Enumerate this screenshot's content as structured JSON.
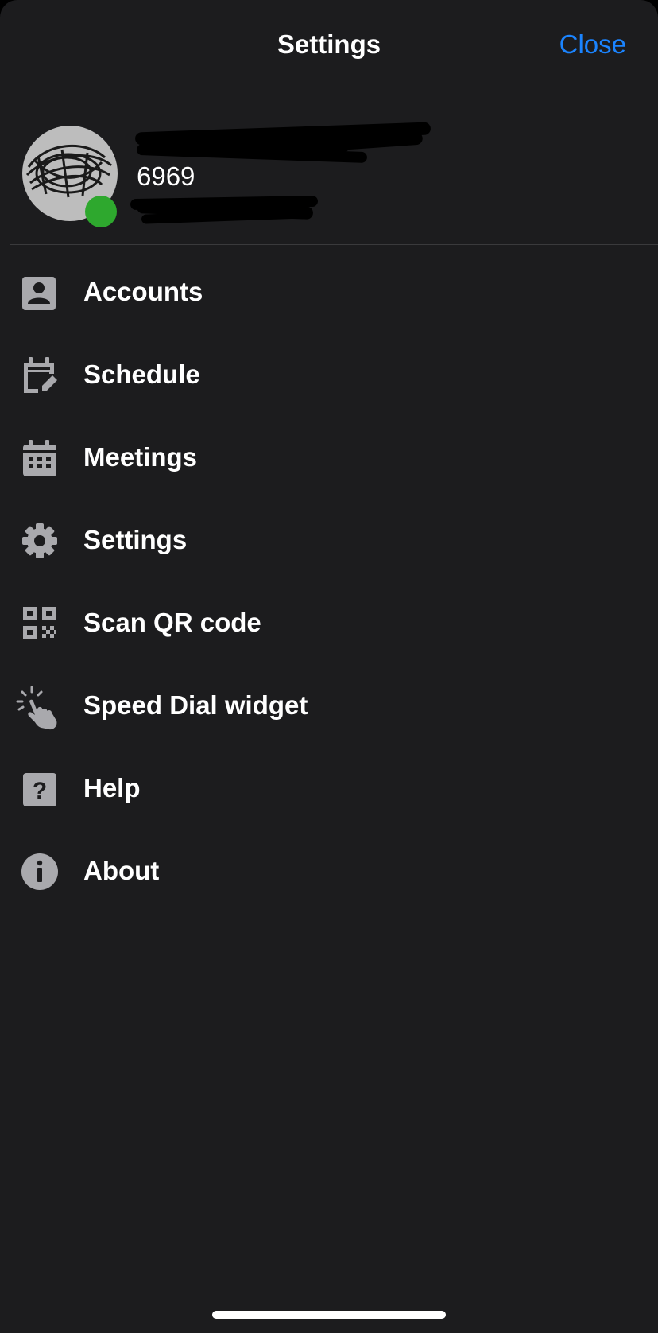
{
  "header": {
    "title": "Settings",
    "close_label": "Close"
  },
  "profile": {
    "extension": "6969",
    "presence_color": "#2ea82e",
    "name_redacted": true,
    "subtitle_redacted": true
  },
  "menu": {
    "items": [
      {
        "label": "Accounts",
        "icon": "account-box-icon"
      },
      {
        "label": "Schedule",
        "icon": "calendar-edit-icon"
      },
      {
        "label": "Meetings",
        "icon": "calendar-grid-icon"
      },
      {
        "label": "Settings",
        "icon": "gear-icon"
      },
      {
        "label": "Scan QR code",
        "icon": "qr-code-icon"
      },
      {
        "label": "Speed Dial widget",
        "icon": "tap-hand-icon"
      },
      {
        "label": "Help",
        "icon": "help-icon"
      },
      {
        "label": "About",
        "icon": "info-icon"
      }
    ]
  },
  "colors": {
    "background": "#1c1c1e",
    "accent": "#1b84ff",
    "icon": "#a9a9ad",
    "text": "#ffffff"
  }
}
